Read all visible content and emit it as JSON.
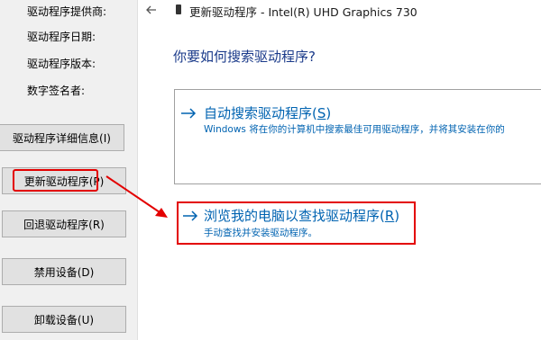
{
  "left_panel": {
    "props": [
      {
        "label": "驱动程序提供商:"
      },
      {
        "label": "驱动程序日期:"
      },
      {
        "label": "驱动程序版本:"
      },
      {
        "label": "数字签名者:"
      }
    ],
    "buttons": [
      {
        "label": "驱动程序详细信息(I)"
      },
      {
        "label": "更新驱动程序(P)"
      },
      {
        "label": "回退驱动程序(R)"
      },
      {
        "label": "禁用设备(D)"
      },
      {
        "label": "卸载设备(U)"
      }
    ]
  },
  "wizard": {
    "window_title": "更新驱动程序 - Intel(R) UHD Graphics 730",
    "question": "你要如何搜索驱动程序?",
    "option_auto": {
      "title": "自动搜索驱动程序(",
      "key": "S",
      "title_end": ")",
      "description": "Windows 将在你的计算机中搜索最佳可用驱动程序，并将其安装在你的"
    },
    "option_browse": {
      "title": "浏览我的电脑以查找驱动程序(",
      "key": "R",
      "title_end": ")",
      "description": "手动查找并安装驱动程序。"
    }
  },
  "colors": {
    "highlight": "#e30000",
    "link": "#0063b1",
    "heading": "#1a3a8a"
  },
  "icons": [
    "back-arrow-icon",
    "device-icon",
    "arrow-right-icon"
  ]
}
